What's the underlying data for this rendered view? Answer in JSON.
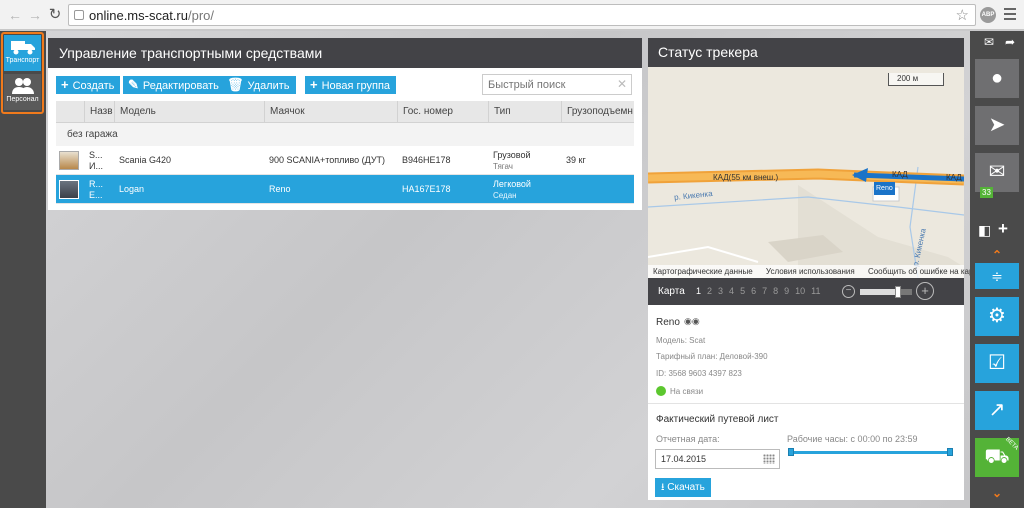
{
  "browser": {
    "url_host": "online.ms-scat.ru",
    "url_path": "/pro/",
    "extension_label": "ABP"
  },
  "left_sidebar": {
    "items": [
      {
        "label": "Транспорт",
        "icon": "truck-icon"
      },
      {
        "label": "Персонал",
        "icon": "people-icon"
      }
    ]
  },
  "vehicles": {
    "title": "Управление транспортными средствами",
    "toolbar": {
      "create": "Создать",
      "edit": "Редактировать",
      "delete": "Удалить",
      "new_group": "Новая группа"
    },
    "search_placeholder": "Быстрый поиск",
    "columns": [
      "Назв",
      "Модель",
      "Маячок",
      "Гос. номер",
      "Тип",
      "Грузоподъемн"
    ],
    "group_label": "без гаража",
    "rows": [
      {
        "name1": "S...",
        "name2": "И...",
        "model": "Scania G420",
        "beacon": "900 SCANIA+топливо (ДУТ)",
        "plate": "В946НЕ178",
        "type1": "Грузовой",
        "type2": "Тягач",
        "capacity": "39 кг",
        "selected": false
      },
      {
        "name1": "R...",
        "name2": "Е...",
        "model": "Logan",
        "beacon": "Reno",
        "plate": "НА167Е178",
        "type1": "Легковой",
        "type2": "Седан",
        "capacity": "",
        "selected": true
      }
    ]
  },
  "tracker": {
    "title": "Статус трекера",
    "map": {
      "scale": "200 м",
      "road_label": "КАД(55 км внеш.)",
      "road_label_short": "КАД",
      "road_label_cut": "КАД",
      "river1": "р. Кикенка",
      "river2": "р. Кикенка",
      "marker_label": "Reno",
      "attribution": [
        "Картографические данные",
        "Условия использования",
        "Сообщить об ошибке на карте"
      ]
    },
    "map_tabs_label": "Карта",
    "map_pages": [
      "1",
      "2",
      "3",
      "4",
      "5",
      "6",
      "7",
      "8",
      "9",
      "10",
      "11"
    ],
    "active_page": "1",
    "zoom_level": 0.7,
    "vehicle": {
      "name": "Reno",
      "model": "Модель: Scat",
      "tariff": "Тарифный план: Деловой-390",
      "id": "ID: 3568 9603 4397 823",
      "status": "На связи"
    },
    "waybill": {
      "title": "Фактический путевой лист",
      "date_label": "Отчетная дата:",
      "date_value": "17.04.2015",
      "hours_label": "Рабочие часы: с 00:00 по 23:59",
      "download": "Скачать"
    }
  },
  "right_sidebar": {
    "messages_badge": "33",
    "beta_label": "BETA"
  },
  "colors": {
    "accent": "#27a3dc",
    "highlight": "#f07a1c",
    "header": "#434347",
    "online": "#5cc72f"
  }
}
